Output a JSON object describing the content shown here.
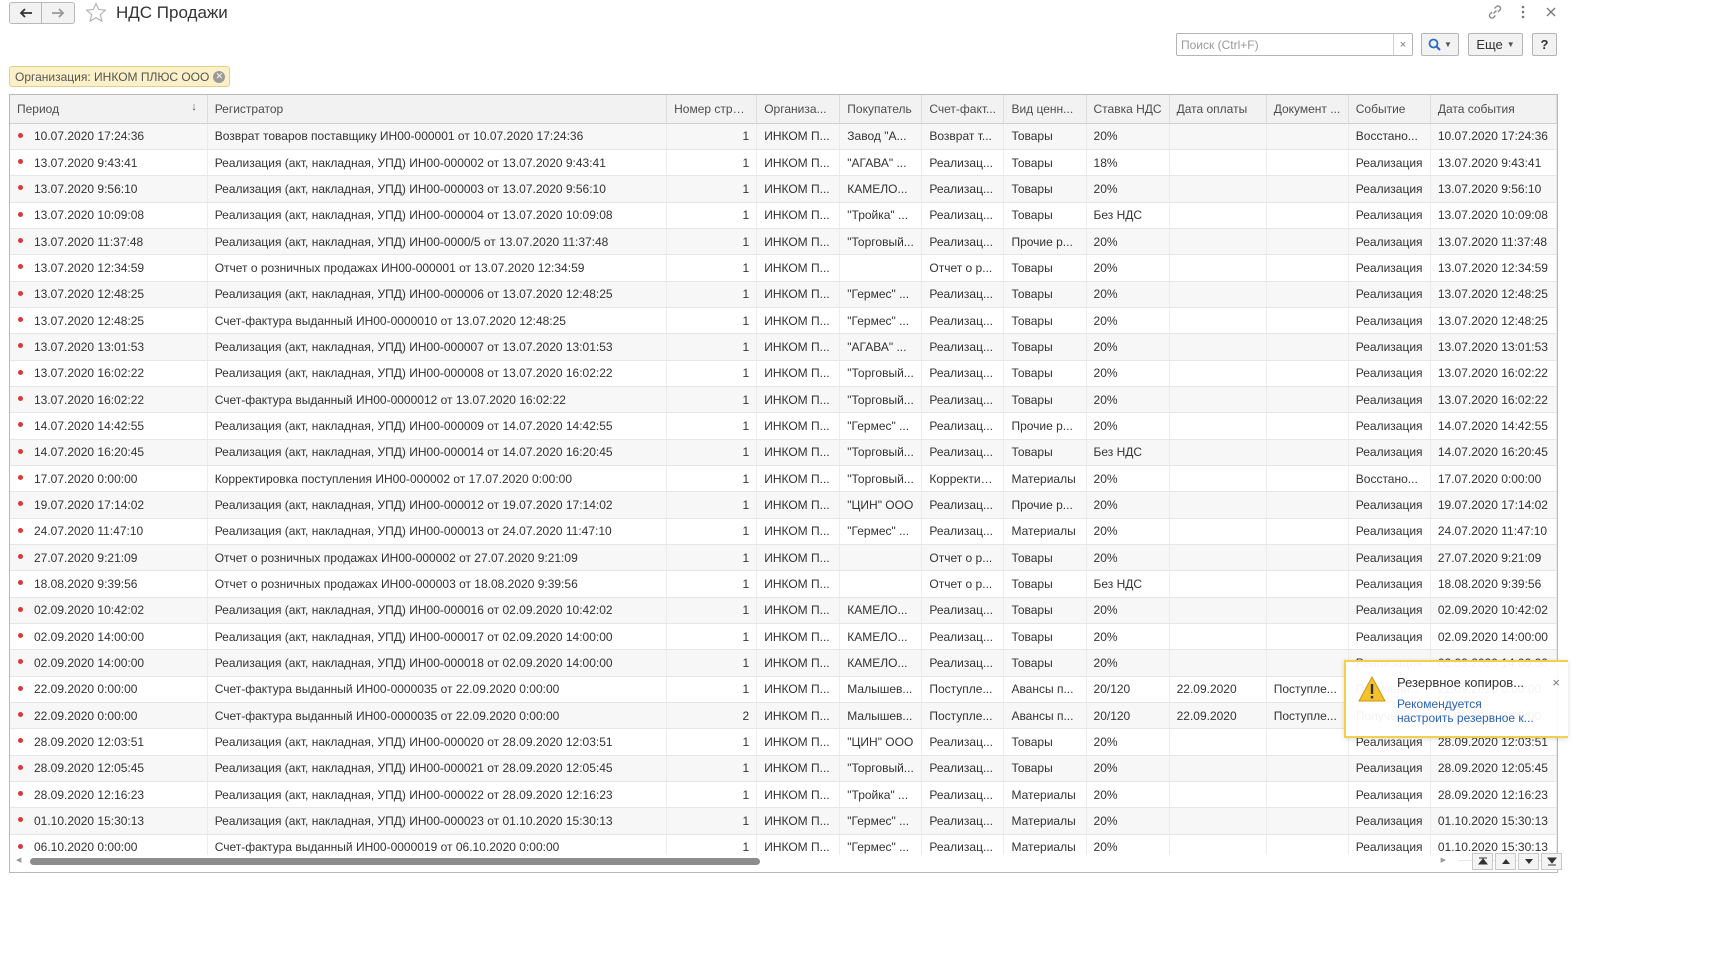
{
  "window": {
    "title": "НДС Продажи"
  },
  "toolbar": {
    "search_placeholder": "Поиск (Ctrl+F)",
    "search_clear": "×",
    "more_label": "Еще",
    "help_label": "?"
  },
  "filter": {
    "label": "Организация: ИНКОМ ПЛЮС ООО"
  },
  "table": {
    "columns": [
      "Период",
      "Регистратор",
      "Номер строки",
      "Организа...",
      "Покупатель",
      "Счет-факт...",
      "Вид ценн...",
      "Ставка НДС",
      "Дата оплаты",
      "Документ ...",
      "Событие",
      "Дата события"
    ],
    "rows": [
      [
        "10.07.2020 17:24:36",
        "Возврат товаров поставщику ИН00-000001 от 10.07.2020 17:24:36",
        "1",
        "ИНКОМ П...",
        "Завод \"А...",
        "Возврат т...",
        "Товары",
        "20%",
        "",
        "",
        "Восстано...",
        "10.07.2020 17:24:36"
      ],
      [
        "13.07.2020 9:43:41",
        "Реализация (акт, накладная, УПД) ИН00-000002 от 13.07.2020 9:43:41",
        "1",
        "ИНКОМ П...",
        "\"АГАВА\" ...",
        "Реализац...",
        "Товары",
        "18%",
        "",
        "",
        "Реализация",
        "13.07.2020 9:43:41"
      ],
      [
        "13.07.2020 9:56:10",
        "Реализация (акт, накладная, УПД) ИН00-000003 от 13.07.2020 9:56:10",
        "1",
        "ИНКОМ П...",
        "КАМЕЛО...",
        "Реализац...",
        "Товары",
        "20%",
        "",
        "",
        "Реализация",
        "13.07.2020 9:56:10"
      ],
      [
        "13.07.2020 10:09:08",
        "Реализация (акт, накладная, УПД) ИН00-000004 от 13.07.2020 10:09:08",
        "1",
        "ИНКОМ П...",
        "\"Тройка\" ...",
        "Реализац...",
        "Товары",
        "Без НДС",
        "",
        "",
        "Реализация",
        "13.07.2020 10:09:08"
      ],
      [
        "13.07.2020 11:37:48",
        "Реализация (акт, накладная, УПД) ИН00-0000/5 от 13.07.2020 11:37:48",
        "1",
        "ИНКОМ П...",
        "\"Торговый...",
        "Реализац...",
        "Прочие р...",
        "20%",
        "",
        "",
        "Реализация",
        "13.07.2020 11:37:48"
      ],
      [
        "13.07.2020 12:34:59",
        "Отчет о розничных продажах ИН00-000001 от 13.07.2020 12:34:59",
        "1",
        "ИНКОМ П...",
        "",
        "Отчет о р...",
        "Товары",
        "20%",
        "",
        "",
        "Реализация",
        "13.07.2020 12:34:59"
      ],
      [
        "13.07.2020 12:48:25",
        "Реализация (акт, накладная, УПД) ИН00-000006 от 13.07.2020 12:48:25",
        "1",
        "ИНКОМ П...",
        "\"Гермес\" ...",
        "Реализац...",
        "Товары",
        "20%",
        "",
        "",
        "Реализация",
        "13.07.2020 12:48:25"
      ],
      [
        "13.07.2020 12:48:25",
        "Счет-фактура выданный ИН00-0000010 от 13.07.2020 12:48:25",
        "1",
        "ИНКОМ П...",
        "\"Гермес\" ...",
        "Реализац...",
        "Товары",
        "20%",
        "",
        "",
        "Реализация",
        "13.07.2020 12:48:25"
      ],
      [
        "13.07.2020 13:01:53",
        "Реализация (акт, накладная, УПД) ИН00-000007 от 13.07.2020 13:01:53",
        "1",
        "ИНКОМ П...",
        "\"АГАВА\" ...",
        "Реализац...",
        "Товары",
        "20%",
        "",
        "",
        "Реализация",
        "13.07.2020 13:01:53"
      ],
      [
        "13.07.2020 16:02:22",
        "Реализация (акт, накладная, УПД) ИН00-000008 от 13.07.2020 16:02:22",
        "1",
        "ИНКОМ П...",
        "\"Торговый...",
        "Реализац...",
        "Товары",
        "20%",
        "",
        "",
        "Реализация",
        "13.07.2020 16:02:22"
      ],
      [
        "13.07.2020 16:02:22",
        "Счет-фактура выданный ИН00-0000012 от 13.07.2020 16:02:22",
        "1",
        "ИНКОМ П...",
        "\"Торговый...",
        "Реализац...",
        "Товары",
        "20%",
        "",
        "",
        "Реализация",
        "13.07.2020 16:02:22"
      ],
      [
        "14.07.2020 14:42:55",
        "Реализация (акт, накладная, УПД) ИН00-000009 от 14.07.2020 14:42:55",
        "1",
        "ИНКОМ П...",
        "\"Гермес\" ...",
        "Реализац...",
        "Прочие р...",
        "20%",
        "",
        "",
        "Реализация",
        "14.07.2020 14:42:55"
      ],
      [
        "14.07.2020 16:20:45",
        "Реализация (акт, накладная, УПД) ИН00-000014 от 14.07.2020 16:20:45",
        "1",
        "ИНКОМ П...",
        "\"Торговый...",
        "Реализац...",
        "Товары",
        "Без НДС",
        "",
        "",
        "Реализация",
        "14.07.2020 16:20:45"
      ],
      [
        "17.07.2020 0:00:00",
        "Корректировка поступления ИН00-000002 от 17.07.2020 0:00:00",
        "1",
        "ИНКОМ П...",
        "\"Торговый...",
        "Корректир...",
        "Материалы",
        "20%",
        "",
        "",
        "Восстано...",
        "17.07.2020 0:00:00"
      ],
      [
        "19.07.2020 17:14:02",
        "Реализация (акт, накладная, УПД) ИН00-000012 от 19.07.2020 17:14:02",
        "1",
        "ИНКОМ П...",
        "\"ЦИН\" ООО",
        "Реализац...",
        "Прочие р...",
        "20%",
        "",
        "",
        "Реализация",
        "19.07.2020 17:14:02"
      ],
      [
        "24.07.2020 11:47:10",
        "Реализация (акт, накладная, УПД) ИН00-000013 от 24.07.2020 11:47:10",
        "1",
        "ИНКОМ П...",
        "\"Гермес\" ...",
        "Реализац...",
        "Материалы",
        "20%",
        "",
        "",
        "Реализация",
        "24.07.2020 11:47:10"
      ],
      [
        "27.07.2020 9:21:09",
        "Отчет о розничных продажах ИН00-000002 от 27.07.2020 9:21:09",
        "1",
        "ИНКОМ П...",
        "",
        "Отчет о р...",
        "Товары",
        "20%",
        "",
        "",
        "Реализация",
        "27.07.2020 9:21:09"
      ],
      [
        "18.08.2020 9:39:56",
        "Отчет о розничных продажах ИН00-000003 от 18.08.2020 9:39:56",
        "1",
        "ИНКОМ П...",
        "",
        "Отчет о р...",
        "Товары",
        "Без НДС",
        "",
        "",
        "Реализация",
        "18.08.2020 9:39:56"
      ],
      [
        "02.09.2020 10:42:02",
        "Реализация (акт, накладная, УПД) ИН00-000016 от 02.09.2020 10:42:02",
        "1",
        "ИНКОМ П...",
        "КАМЕЛО...",
        "Реализац...",
        "Товары",
        "20%",
        "",
        "",
        "Реализация",
        "02.09.2020 10:42:02"
      ],
      [
        "02.09.2020 14:00:00",
        "Реализация (акт, накладная, УПД) ИН00-000017 от 02.09.2020 14:00:00",
        "1",
        "ИНКОМ П...",
        "КАМЕЛО...",
        "Реализац...",
        "Товары",
        "20%",
        "",
        "",
        "Реализация",
        "02.09.2020 14:00:00"
      ],
      [
        "02.09.2020 14:00:00",
        "Реализация (акт, накладная, УПД) ИН00-000018 от 02.09.2020 14:00:00",
        "1",
        "ИНКОМ П...",
        "КАМЕЛО...",
        "Реализац...",
        "Товары",
        "20%",
        "",
        "",
        "Реализация",
        "02.09.2020 14:00:00"
      ],
      [
        "22.09.2020 0:00:00",
        "Счет-фактура выданный ИН00-0000035 от 22.09.2020 0:00:00",
        "1",
        "ИНКОМ П...",
        "Малышев...",
        "Поступле...",
        "Авансы п...",
        "20/120",
        "22.09.2020",
        "Поступле...",
        "Получение...",
        "22.09.2020 0:00:00"
      ],
      [
        "22.09.2020 0:00:00",
        "Счет-фактура выданный ИН00-0000035 от 22.09.2020 0:00:00",
        "2",
        "ИНКОМ П...",
        "Малышев...",
        "Поступле...",
        "Авансы п...",
        "20/120",
        "22.09.2020",
        "Поступле...",
        "Получение...",
        "22.09.2020 0:00:00"
      ],
      [
        "28.09.2020 12:03:51",
        "Реализация (акт, накладная, УПД) ИН00-000020 от 28.09.2020 12:03:51",
        "1",
        "ИНКОМ П...",
        "\"ЦИН\" ООО",
        "Реализац...",
        "Товары",
        "20%",
        "",
        "",
        "Реализация",
        "28.09.2020 12:03:51"
      ],
      [
        "28.09.2020 12:05:45",
        "Реализация (акт, накладная, УПД) ИН00-000021 от 28.09.2020 12:05:45",
        "1",
        "ИНКОМ П...",
        "\"Торговый...",
        "Реализац...",
        "Товары",
        "20%",
        "",
        "",
        "Реализация",
        "28.09.2020 12:05:45"
      ],
      [
        "28.09.2020 12:16:23",
        "Реализация (акт, накладная, УПД) ИН00-000022 от 28.09.2020 12:16:23",
        "1",
        "ИНКОМ П...",
        "\"Тройка\" ...",
        "Реализац...",
        "Материалы",
        "20%",
        "",
        "",
        "Реализация",
        "28.09.2020 12:16:23"
      ],
      [
        "01.10.2020 15:30:13",
        "Реализация (акт, накладная, УПД) ИН00-000023 от 01.10.2020 15:30:13",
        "1",
        "ИНКОМ П...",
        "\"Гермес\" ...",
        "Реализац...",
        "Материалы",
        "20%",
        "",
        "",
        "Реализация",
        "01.10.2020 15:30:13"
      ],
      [
        "06.10.2020 0:00:00",
        "Счет-фактура выданный ИН00-0000019 от 06.10.2020 0:00:00",
        "1",
        "ИНКОМ П...",
        "\"Гермес\" ...",
        "Реализац...",
        "Материалы",
        "20%",
        "",
        "",
        "Реализация",
        "01.10.2020 15:30:13"
      ]
    ]
  },
  "notification": {
    "title": "Резервное копиров...",
    "line1": "Рекомендуется",
    "line2": "настроить резервное к...",
    "close": "×"
  },
  "colors": {
    "row_marker": "#d9383a",
    "filter_chip_bg": "#fbf0c8",
    "notification_border": "#f3cf4a",
    "link": "#2a61b8"
  }
}
